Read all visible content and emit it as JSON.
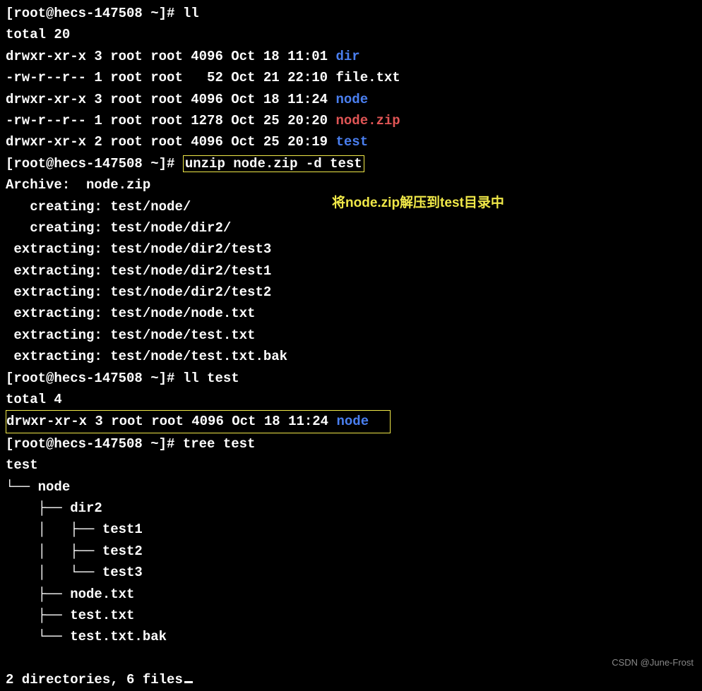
{
  "prompt1": "[root@hecs-147508 ~]# ll",
  "total1": "total 20",
  "ll_entries": [
    {
      "perms": "drwxr-xr-x 3 root root 4096 Oct 18 11:01 ",
      "name": "dir",
      "cls": "blue"
    },
    {
      "perms": "-rw-r--r-- 1 root root   52 Oct 21 22:10 ",
      "name": "file.txt",
      "cls": "white"
    },
    {
      "perms": "drwxr-xr-x 3 root root 4096 Oct 18 11:24 ",
      "name": "node",
      "cls": "blue"
    },
    {
      "perms": "-rw-r--r-- 1 root root 1278 Oct 25 20:20 ",
      "name": "node.zip",
      "cls": "red"
    },
    {
      "perms": "drwxr-xr-x 2 root root 4096 Oct 25 20:19 ",
      "name": "test",
      "cls": "blue"
    }
  ],
  "prompt2_prefix": "[root@hecs-147508 ~]# ",
  "prompt2_cmd": "unzip node.zip -d test",
  "annotation": "将node.zip解压到test目录中",
  "archive_line": "Archive:  node.zip",
  "unzip_lines": [
    "   creating: test/node/",
    "   creating: test/node/dir2/",
    " extracting: test/node/dir2/test3   ",
    " extracting: test/node/dir2/test1   ",
    " extracting: test/node/dir2/test2   ",
    " extracting: test/node/node.txt     ",
    " extracting: test/node/test.txt     ",
    " extracting: test/node/test.txt.bak "
  ],
  "prompt3": "[root@hecs-147508 ~]# ll test",
  "total2": "total 4",
  "test_entry_perms": "drwxr-xr-x 3 root root 4096 Oct 18 11:24 ",
  "test_entry_name": "node",
  "prompt4": "[root@hecs-147508 ~]# tree test",
  "tree_lines": [
    "test",
    "└── node",
    "    ├── dir2",
    "    │   ├── test1",
    "    │   ├── test2",
    "    │   └── test3",
    "    ├── node.txt",
    "    ├── test.txt",
    "    └── test.txt.bak"
  ],
  "tree_summary": "2 directories, 6 files",
  "watermark": "CSDN @June-Frost"
}
